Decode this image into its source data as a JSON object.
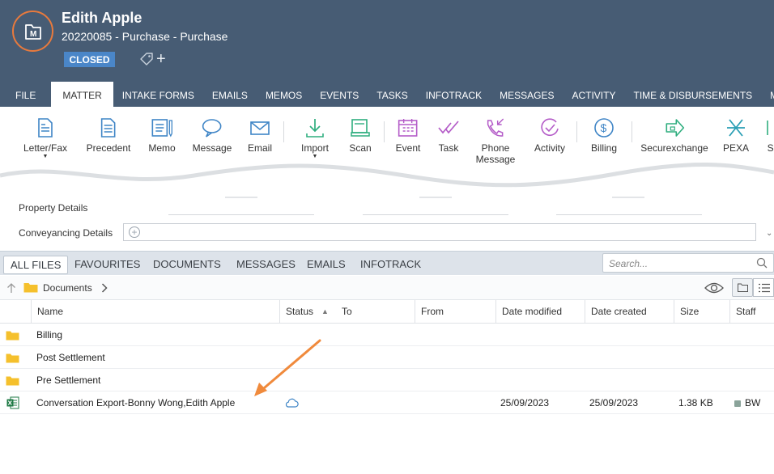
{
  "header": {
    "title": "Edith Apple",
    "subtitle": "20220085 - Purchase - Purchase",
    "status": "CLOSED",
    "avatar_icon": "matter-folder-icon",
    "colors": {
      "header_bg": "#475c74",
      "accent": "#e87a3d",
      "badge": "#4a86c8"
    }
  },
  "tabs": [
    "FILE",
    "MATTER",
    "INTAKE FORMS",
    "EMAILS",
    "MEMOS",
    "EVENTS",
    "TASKS",
    "INFOTRACK",
    "MESSAGES",
    "ACTIVITY",
    "TIME & DISBURSEMENTS",
    "MA"
  ],
  "active_tab": "MATTER",
  "ribbon": {
    "letter": "Letter/Fax",
    "precedent": "Precedent",
    "memo": "Memo",
    "message": "Message",
    "email": "Email",
    "import": "Import",
    "scan": "Scan",
    "event": "Event",
    "task": "Task",
    "phone1": "Phone",
    "phone2": "Message",
    "activity": "Activity",
    "billing": "Billing",
    "securexchange": "Securexchange",
    "pexa": "PEXA",
    "se": "Se"
  },
  "details": {
    "property": "Property Details",
    "conveyancing": "Conveyancing Details"
  },
  "files_tabs": [
    "ALL FILES",
    "FAVOURITES",
    "DOCUMENTS",
    "MESSAGES",
    "EMAILS",
    "INFOTRACK"
  ],
  "search": {
    "placeholder": "Search..."
  },
  "breadcrumb": {
    "folder": "Documents"
  },
  "columns": {
    "name": "Name",
    "status": "Status",
    "to": "To",
    "from": "From",
    "modified": "Date modified",
    "created": "Date created",
    "size": "Size",
    "staff": "Staff"
  },
  "rows": [
    {
      "name": "Billing",
      "type": "folder"
    },
    {
      "name": "Post Settlement",
      "type": "folder"
    },
    {
      "name": "Pre Settlement",
      "type": "folder"
    },
    {
      "name": "Conversation Export-Bonny Wong,Edith Apple",
      "type": "excel",
      "modified": "25/09/2023",
      "created": "25/09/2023",
      "size": "1.38 KB",
      "staff": "BW",
      "status_icon": "cloud-icon"
    }
  ]
}
